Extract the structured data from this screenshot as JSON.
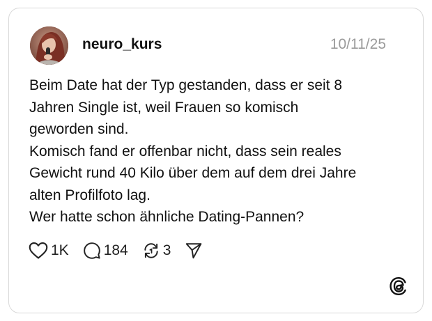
{
  "post": {
    "username": "neuro_kurs",
    "date": "10/11/25",
    "lines": [
      "Beim Date hat der Typ gestanden, dass er seit 8",
      "Jahren Single ist, weil Frauen so komisch",
      "geworden sind.",
      "Komisch fand er offenbar nicht, dass sein reales",
      "Gewicht rund 40 Kilo über dem auf dem drei Jahre",
      "alten Profilfoto lag.",
      "Wer hatte schon ähnliche Dating-Pannen?"
    ]
  },
  "actions": {
    "likes": "1K",
    "replies": "184",
    "reposts": "3"
  },
  "icons": {
    "like": "heart-icon",
    "reply": "speech-bubble-icon",
    "repost": "repost-arrows-icon",
    "share": "send-icon",
    "brand": "threads-logo-icon"
  },
  "colors": {
    "text": "#111111",
    "muted": "#9b9b9b",
    "border": "#d9d9d9"
  }
}
